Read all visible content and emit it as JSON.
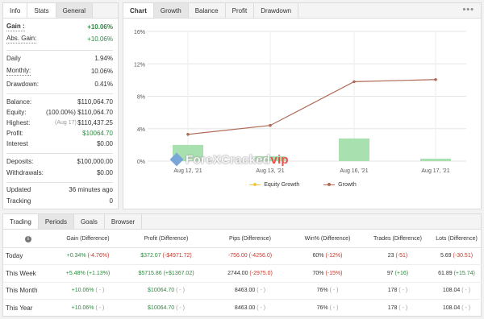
{
  "left_tabs": [
    "Info",
    "Stats",
    "General"
  ],
  "stats": {
    "gain": {
      "label": "Gain :",
      "value": "+10.06%"
    },
    "abs_gain": {
      "label": "Abs. Gain:",
      "value": "+10.06%"
    },
    "daily": {
      "label": "Daily",
      "value": "1.94%"
    },
    "monthly": {
      "label": "Monthly:",
      "value": "10.06%"
    },
    "drawdown": {
      "label": "Drawdown:",
      "value": "0.41%"
    },
    "balance": {
      "label": "Balance:",
      "value": "$110,064.70"
    },
    "equity": {
      "label": "Equity:",
      "value": "(100.00%) $110,064.70"
    },
    "highest": {
      "label": "Highest:",
      "note": "(Aug 17)",
      "value": "$110,437.25"
    },
    "profit": {
      "label": "Profit:",
      "value": "$10064.70"
    },
    "interest": {
      "label": "Interest",
      "value": "$0.00"
    },
    "deposits": {
      "label": "Deposits:",
      "value": "$100,000.00"
    },
    "withdrawals": {
      "label": "Withdrawals:",
      "value": "$0.00"
    },
    "updated": {
      "label": "Updated",
      "value": "36 minutes ago"
    },
    "tracking": {
      "label": "Tracking",
      "value": "0"
    }
  },
  "chart_tabs": [
    "Chart",
    "Growth",
    "Balance",
    "Profit",
    "Drawdown"
  ],
  "more_label": "•••",
  "watermark": {
    "main": "ForeXCracked",
    "accent": "vip"
  },
  "chart_data": {
    "type": "bar",
    "categories": [
      "Aug 12, '21",
      "Aug 13, '21",
      "Aug 16, '21",
      "Aug 17, '21"
    ],
    "series": [
      {
        "name": "Equity Growth",
        "values": [
          3.3,
          4.4,
          9.8,
          10.06
        ]
      },
      {
        "name": "Growth",
        "values": [
          2.0,
          0.6,
          2.8,
          0.3
        ]
      }
    ],
    "y_ticks": [
      "0%",
      "4%",
      "8%",
      "12%",
      "16%"
    ],
    "ylim": [
      0,
      16
    ],
    "grid": true,
    "legend": "bottom",
    "colors": {
      "line": "#b06a55",
      "bar": "#a8e0b0",
      "equity_swatch": "#f5c542"
    }
  },
  "bottom_tabs": [
    "Trading",
    "Periods",
    "Goals",
    "Browser"
  ],
  "table": {
    "headers": [
      "Gain (Difference)",
      "Profit (Difference)",
      "Pips (Difference)",
      "Win% (Difference)",
      "Trades (Difference)",
      "Lots (Difference)"
    ],
    "rows": [
      {
        "label": "Today",
        "gain": "+0.34%",
        "gain_d": "(-4.76%)",
        "profit": "$372.07",
        "profit_d": "(-$4971.72)",
        "pips": "-756.00",
        "pips_d": "(-4256.0)",
        "win": "60%",
        "win_d": "(-12%)",
        "trades": "23",
        "trades_d": "(-51)",
        "lots": "5.69",
        "lots_d": "(-30.51)"
      },
      {
        "label": "This Week",
        "gain": "+5.48%",
        "gain_d": "(+1.13%)",
        "profit": "$5715.86",
        "profit_d": "(+$1367.02)",
        "pips": "2744.00",
        "pips_d": "(-2975.0)",
        "win": "70%",
        "win_d": "(-15%)",
        "trades": "97",
        "trades_d": "(+16)",
        "lots": "61.89",
        "lots_d": "(+15.74)"
      },
      {
        "label": "This Month",
        "gain": "+10.06%",
        "gain_d": "( - )",
        "profit": "$10064.70",
        "profit_d": "( - )",
        "pips": "8463.00",
        "pips_d": "( - )",
        "win": "76%",
        "win_d": "( - )",
        "trades": "178",
        "trades_d": "( - )",
        "lots": "108.04",
        "lots_d": "( - )"
      },
      {
        "label": "This Year",
        "gain": "+10.06%",
        "gain_d": "( - )",
        "profit": "$10064.70",
        "profit_d": "( - )",
        "pips": "8463.00",
        "pips_d": "( - )",
        "win": "76%",
        "win_d": "( - )",
        "trades": "178",
        "trades_d": "( - )",
        "lots": "108.04",
        "lots_d": "( - )"
      }
    ]
  }
}
